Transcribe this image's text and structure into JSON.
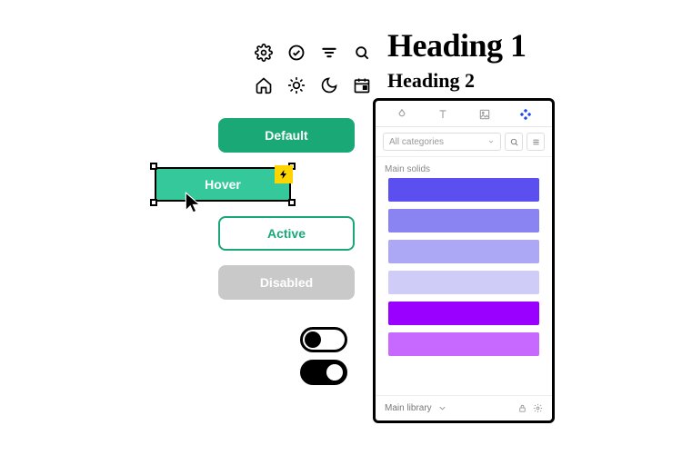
{
  "headings": {
    "h1": "Heading 1",
    "h2": "Heading 2"
  },
  "icons": [
    "gear-icon",
    "check-circle-icon",
    "filter-icon",
    "search-icon",
    "home-icon",
    "sun-icon",
    "moon-icon",
    "calendar-icon"
  ],
  "buttons": {
    "default": "Default",
    "hover": "Hover",
    "active": "Active",
    "disabled": "Disabled"
  },
  "toggles": {
    "off": false,
    "on": true
  },
  "panel": {
    "tabs": [
      "droplet-icon",
      "type-icon",
      "image-icon",
      "components-icon"
    ],
    "active_tab_index": 3,
    "categories_label": "All categories",
    "section_label": "Main solids",
    "swatches": [
      "#5b4ff0",
      "#8a84f2",
      "#aca8f5",
      "#cfccf8",
      "#9a00ff",
      "#c768ff"
    ],
    "footer_label": "Main library"
  }
}
